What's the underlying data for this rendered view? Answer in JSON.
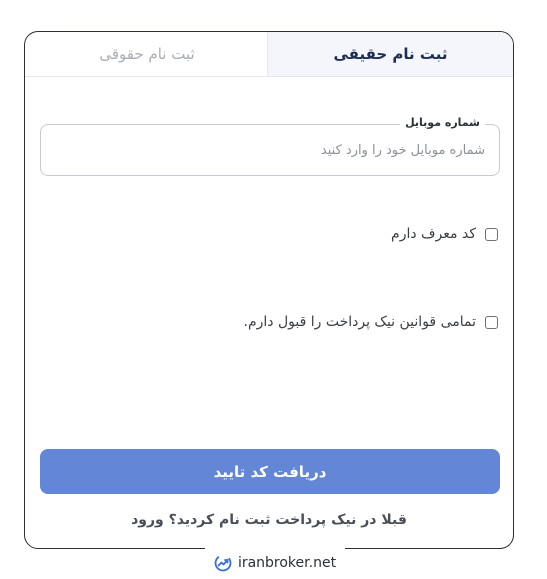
{
  "tabs": [
    {
      "label": "ثبت نام حقیقی",
      "active": true
    },
    {
      "label": "ثبت نام حقوقی",
      "active": false
    }
  ],
  "mobile_field": {
    "label": "شماره موبایل",
    "placeholder": "شماره موبایل خود را وارد کنید",
    "value": ""
  },
  "referral_checkbox": {
    "label": "کد معرف دارم",
    "checked": false
  },
  "terms_checkbox": {
    "label": "تمامی قوانین نیک پرداخت را قبول دارم.",
    "checked": false
  },
  "submit_button": {
    "label": "دریافت کد تایید"
  },
  "login_prompt": {
    "text": "قبلا در نیک پرداخت ثبت نام کردید؟",
    "link": "ورود"
  },
  "watermark": {
    "text": "iranbroker.net"
  },
  "colors": {
    "primary_button": "#6386d6",
    "active_tab_bg": "#f4f6fb",
    "active_tab_text": "#1f2f52",
    "inactive_tab_text": "#a9adb5",
    "card_border": "#2b2f36"
  },
  "icons": {
    "watermark_logo": "trend-up-logo-icon"
  }
}
